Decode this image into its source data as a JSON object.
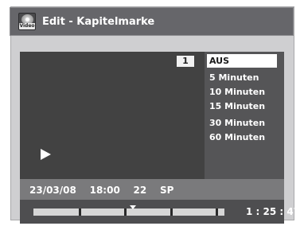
{
  "header": {
    "icon": "video-disc-icon",
    "icon_label": "Video",
    "title": "Edit - Kapitelmarke"
  },
  "preview": {
    "chapter_number": "1",
    "state_icon": "play-icon"
  },
  "menu": {
    "items": [
      {
        "label": "AUS",
        "selected": true
      },
      {
        "label": "5 Minuten",
        "selected": false
      },
      {
        "label": "10 Minuten",
        "selected": false
      },
      {
        "label": "15 Minuten",
        "selected": false
      },
      {
        "label": "30 Minuten",
        "selected": false
      },
      {
        "label": "60 Minuten",
        "selected": false
      }
    ]
  },
  "status": {
    "date": "23/03/08",
    "time": "18:00",
    "channel": "22",
    "mode": "SP"
  },
  "timeline": {
    "elapsed": "1 : 25 : 47"
  }
}
